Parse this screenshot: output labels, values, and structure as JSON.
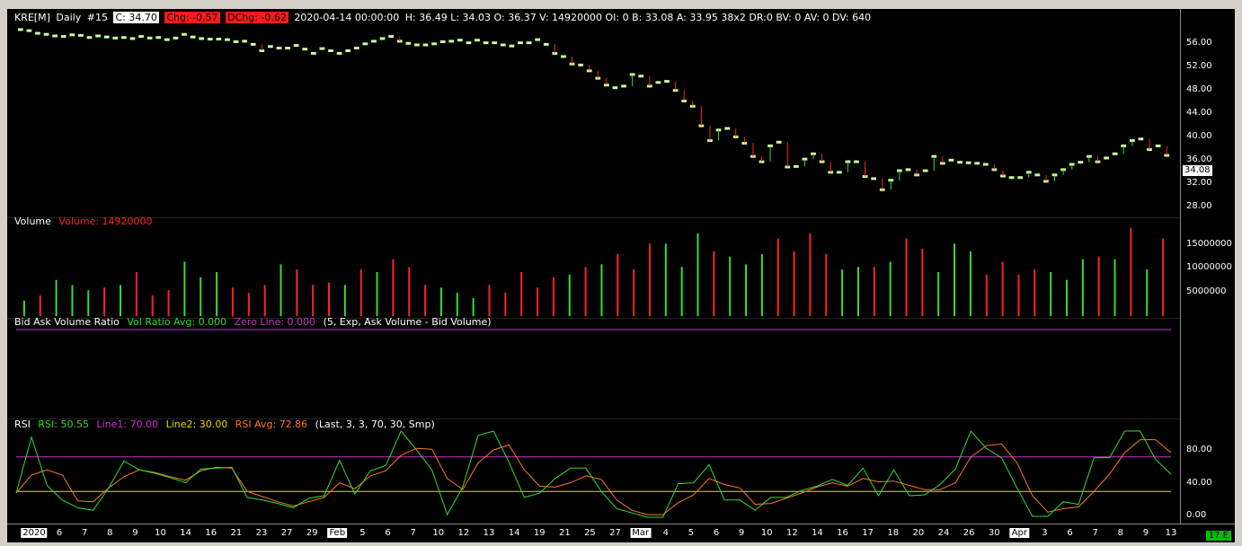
{
  "title_bar": {
    "symbol": "KRE[M]",
    "interval": "Daily",
    "chart_num": "#15",
    "close": "C: 34.70",
    "change": "Chg: -0.57",
    "dchange": "DChg: -0.62",
    "datetime": "2020-04-14 00:00:00",
    "details": "H: 36.49 L: 34.03 O: 36.37 V: 14920000 OI: 0 B: 33.08 A: 33.95 38x2 DR:0 BV: 0 AV: 0 DV: 640"
  },
  "price_axis": {
    "labels": [
      "56.00",
      "52.00",
      "48.00",
      "44.00",
      "40.00",
      "36.00",
      "32.00",
      "28.00"
    ],
    "current_tag": "34.08"
  },
  "volume_panel": {
    "name": "Volume",
    "value": "Volume: 14920000",
    "axis_labels": [
      "15000000",
      "10000000",
      "5000000"
    ]
  },
  "bidask_panel": {
    "name": "Bid Ask Volume Ratio",
    "vol_ratio": "Vol Ratio Avg: 0.000",
    "zero_line": "Zero Line: 0.000",
    "params": "(5, Exp, Ask Volume - Bid Volume)"
  },
  "rsi_panel": {
    "name": "RSI",
    "rsi": "RSI: 50.55",
    "line1": "Line1: 70.00",
    "line2": "Line2: 30.00",
    "rsi_avg": "RSI Avg: 72.86",
    "params": "(Last, 3, 3, 70, 30, Smp)",
    "axis_labels": [
      "80.00",
      "40.00",
      "0.00"
    ]
  },
  "time_axis": {
    "labels": [
      "2020",
      "6",
      "7",
      "8",
      "9",
      "10",
      "14",
      "16",
      "21",
      "23",
      "27",
      "29",
      "Feb",
      "5",
      "6",
      "7",
      "10",
      "12",
      "13",
      "14",
      "19",
      "21",
      "25",
      "27",
      "Mar",
      "4",
      "5",
      "6",
      "9",
      "10",
      "12",
      "14",
      "16",
      "17",
      "18",
      "20",
      "24",
      "26",
      "30",
      "Apr",
      "3",
      "6",
      "7",
      "8",
      "9",
      "13"
    ],
    "corner_badge": "17 E"
  },
  "colors": {
    "background": "#000000",
    "price_bar": "#ccff99",
    "up": "#33dd33",
    "down": "#ff2222",
    "rsi": "#33dd33",
    "rsi_avg": "#ff7722",
    "line1": "#cc33cc",
    "line2": "#dddd00",
    "zero_line": "#cc33cc"
  },
  "chart_data": [
    {
      "type": "bar",
      "ylim": [
        24,
        59
      ],
      "series": [
        {
          "values": [
            58.5,
            58.3,
            57.8,
            57.6,
            57.3,
            57.2,
            57.5,
            57.4,
            57.0,
            57.3,
            57.1,
            56.9,
            57.0,
            56.8,
            57.2,
            56.9,
            57.0,
            56.6,
            56.9,
            57.6,
            57.1,
            56.8,
            56.7,
            56.7,
            56.6,
            56.2,
            56.3,
            55.7,
            54.5,
            55.3,
            55.0,
            55.0,
            55.5,
            54.8,
            54.0,
            54.9,
            54.5,
            54.0,
            54.5,
            55.0,
            55.8,
            56.3,
            56.8,
            57.2,
            56.3,
            55.9,
            55.6,
            55.6,
            55.8,
            56.2,
            56.3,
            56.5,
            56.0,
            56.5,
            56.0,
            56.0,
            55.6,
            55.4,
            56.0,
            56.0,
            56.6,
            55.7,
            54.0,
            53.4,
            52.0,
            51.8,
            50.7,
            49.3,
            48.0,
            47.5,
            47.8,
            50.0,
            49.7,
            47.8,
            48.5,
            48.7,
            47.0,
            45.0,
            44.0,
            40.3,
            37.5,
            39.5,
            39.8,
            38.2,
            37.0,
            34.5,
            33.5,
            36.5,
            37.2,
            32.5,
            32.6,
            34.0,
            35.0,
            33.5,
            31.5,
            31.5,
            33.5,
            33.5,
            30.7,
            30.3,
            28.2,
            30.0,
            31.8,
            32.0,
            31.0,
            31.8,
            34.5,
            33.2,
            33.8,
            33.4,
            33.3,
            33.2,
            33.0,
            32.0,
            30.8,
            30.5,
            30.5,
            31.5,
            31.0,
            29.8,
            31.0,
            32.0,
            33.0,
            33.4,
            34.5,
            33.5,
            34.2,
            35.0,
            36.5,
            37.5,
            37.8,
            35.8,
            36.5,
            34.7
          ]
        }
      ]
    },
    {
      "type": "bar",
      "series": [
        {
          "values": [
            3,
            4,
            7,
            6,
            5,
            5.5,
            6,
            8.5,
            4,
            5,
            10.5,
            7.5,
            8.5,
            5.5,
            4.5,
            6,
            10,
            9,
            6,
            6.5,
            6,
            9,
            8.5,
            11,
            9.5,
            6,
            5.5,
            4.5,
            3.5,
            6,
            4.5,
            8.5,
            5.5,
            7.5,
            8,
            9.5,
            10,
            12,
            9,
            14,
            14,
            9.5,
            16,
            12.5,
            11.5,
            10,
            12,
            15,
            12.5,
            16,
            12,
            9,
            9.5,
            9.5,
            10.5,
            15,
            13,
            8.5,
            14,
            12.5,
            8,
            10.5,
            8,
            9,
            8.5,
            7,
            11,
            11.5,
            11,
            17,
            9,
            15
          ]
        }
      ]
    },
    {
      "type": "line",
      "ylim": [
        0,
        100
      ],
      "series": [
        {
          "values": [
            28,
            93,
            37,
            20,
            11,
            8,
            34,
            65,
            55,
            51,
            46,
            40,
            56,
            57,
            58,
            23,
            20,
            16,
            11,
            22,
            25,
            66,
            27,
            54,
            60,
            100,
            78,
            55,
            3,
            35,
            95,
            100,
            64,
            23,
            28,
            45,
            57,
            57,
            30,
            10,
            5,
            0,
            0,
            39,
            40,
            61,
            20,
            20,
            8,
            23,
            23,
            31,
            36,
            44,
            37,
            57,
            25,
            55,
            25,
            26,
            38,
            56,
            100,
            80,
            69,
            34,
            1,
            1,
            18,
            15,
            69,
            69,
            100,
            100,
            67,
            50
          ]
        },
        {
          "values": [
            28,
            49,
            55,
            49,
            19,
            18,
            34,
            47,
            55,
            52,
            47,
            43,
            54,
            58,
            57,
            30,
            24,
            18,
            13,
            18,
            23,
            40,
            33,
            48,
            54,
            72,
            80,
            79,
            45,
            32,
            63,
            78,
            84,
            55,
            36,
            35,
            40,
            48,
            44,
            20,
            8,
            3,
            3,
            17,
            26,
            45,
            38,
            34,
            15,
            16,
            22,
            28,
            35,
            40,
            36,
            45,
            41,
            42,
            37,
            32,
            32,
            40,
            70,
            83,
            85,
            63,
            25,
            6,
            10,
            12,
            30,
            50,
            75,
            90,
            90,
            75
          ]
        },
        {
          "values": [
            70,
            70
          ]
        },
        {
          "values": [
            30,
            30
          ]
        }
      ]
    }
  ]
}
